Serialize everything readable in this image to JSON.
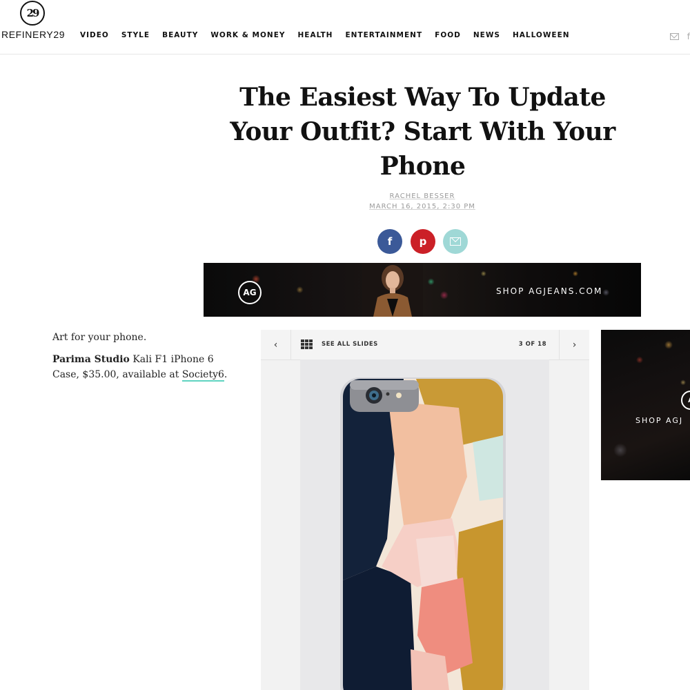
{
  "header": {
    "logo_mark": "29",
    "logo_text": "REFINERY29",
    "nav": [
      "VIDEO",
      "STYLE",
      "BEAUTY",
      "WORK & MONEY",
      "HEALTH",
      "ENTERTAINMENT",
      "FOOD",
      "NEWS",
      "HALLOWEEN"
    ],
    "icons": [
      "mail-icon",
      "facebook-icon"
    ],
    "facebook_glyph": "f"
  },
  "article": {
    "title": "The Easiest Way To Update Your Outfit? Start With Your Phone",
    "author": "RACHEL BESSER",
    "date": "MARCH 16, 2015, 2:30 PM",
    "share": {
      "facebook_glyph": "f",
      "pinterest_glyph": "p",
      "colors": {
        "facebook": "#3b5998",
        "pinterest": "#cb2027",
        "email": "#9fd8d6"
      }
    }
  },
  "ad_banner": {
    "logo": "AG",
    "cta": "SHOP AGJEANS.COM"
  },
  "caption": {
    "intro": "Art for your phone.",
    "brand": "Parima Studio",
    "description": " Kali F1 iPhone 6 Case, $35.00, available at ",
    "link": "Society6",
    "period": "."
  },
  "slideshow": {
    "prev_glyph": "‹",
    "next_glyph": "›",
    "see_all": "SEE ALL SLIDES",
    "counter": "3 OF 18",
    "accent_color": "#5fd3c0"
  },
  "side_ad": {
    "logo": "A",
    "cta": "SHOP AGJ"
  }
}
